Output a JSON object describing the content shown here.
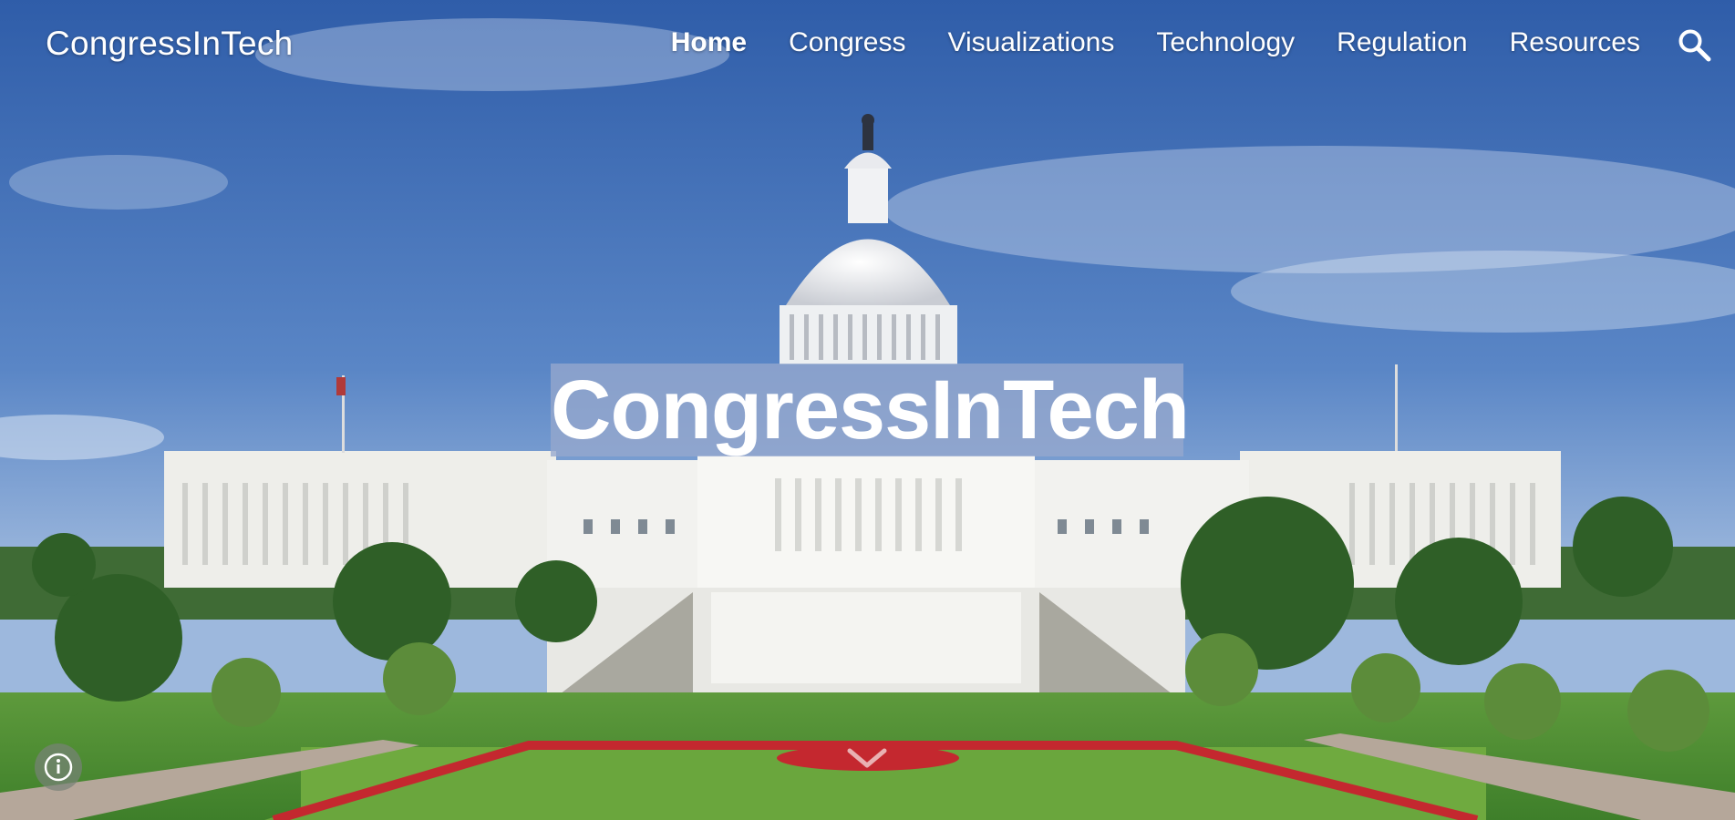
{
  "site": {
    "title": "CongressInTech"
  },
  "nav": {
    "items": [
      {
        "label": "Home",
        "active": true
      },
      {
        "label": "Congress",
        "active": false
      },
      {
        "label": "Visualizations",
        "active": false
      },
      {
        "label": "Technology",
        "active": false
      },
      {
        "label": "Regulation",
        "active": false
      },
      {
        "label": "Resources",
        "active": false
      }
    ],
    "search_icon": "search-icon"
  },
  "hero": {
    "title": "CongressInTech",
    "background": "us-capitol-building-photo",
    "title_band_color": "#96a8cd"
  },
  "controls": {
    "info_icon": "info-icon",
    "scroll_icon": "chevron-down-icon"
  }
}
